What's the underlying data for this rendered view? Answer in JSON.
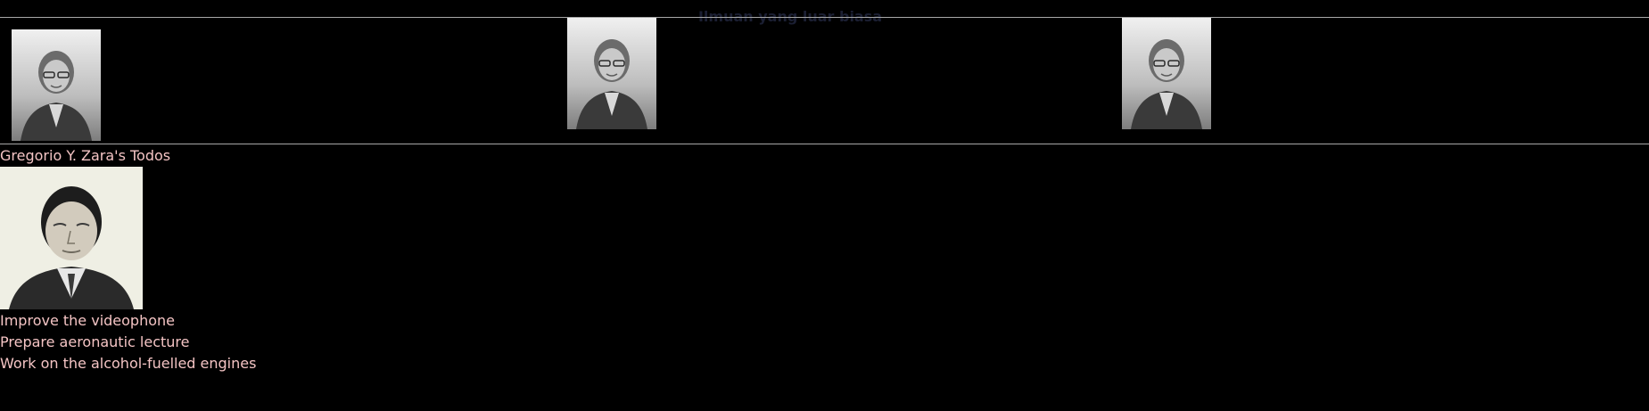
{
  "header": {
    "title": "Ilmuan yang luar biasa"
  },
  "gallery": {
    "items": [
      {
        "icon": "portrait-photo"
      },
      {
        "icon": "portrait-photo"
      },
      {
        "icon": "portrait-photo"
      }
    ]
  },
  "profile": {
    "title": "Gregorio Y. Zara's Todos",
    "avatar_icon": "portrait-photo"
  },
  "todos": [
    "Improve the videophone",
    "Prepare aeronautic lecture",
    "Work on the alcohol-fuelled engines"
  ],
  "colors": {
    "background": "#000000",
    "text": "#f4c4c4",
    "heading": "#1b1f33",
    "divider": "#a7a7a7"
  }
}
